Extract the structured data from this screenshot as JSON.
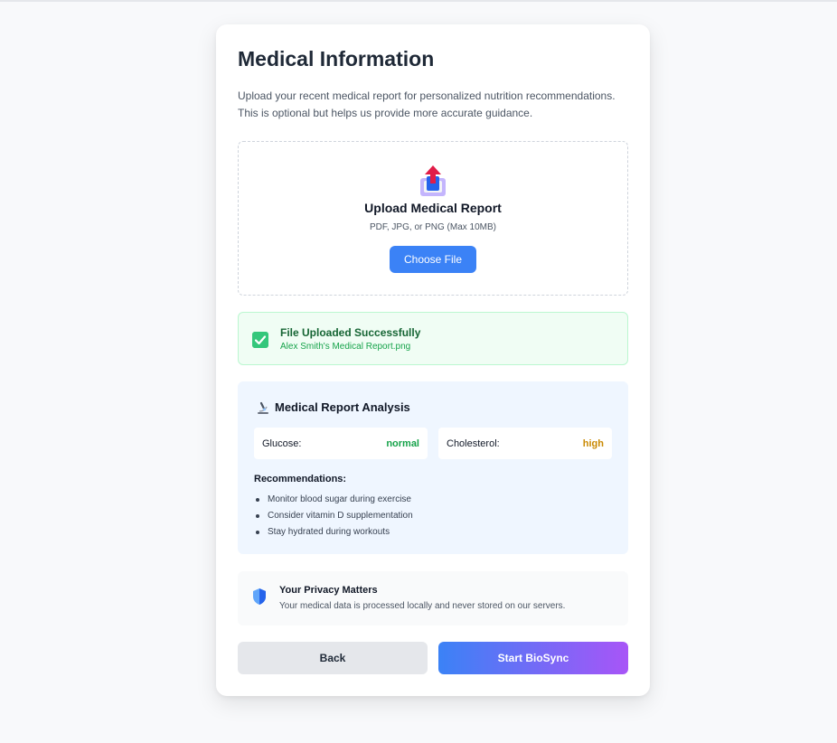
{
  "page": {
    "title": "Medical Information",
    "intro": "Upload your recent medical report for personalized nutrition recommendations. This is optional but helps us provide more accurate guidance."
  },
  "upload": {
    "icon": "upload-tray-icon",
    "title": "Upload Medical Report",
    "hint": "PDF, JPG, or PNG (Max 10MB)",
    "button_label": "Choose File"
  },
  "success": {
    "icon": "checkmark-icon",
    "title": "File Uploaded Successfully",
    "filename": "Alex Smith's Medical Report.png"
  },
  "analysis": {
    "icon": "microscope-icon",
    "title": "Medical Report Analysis",
    "metrics": [
      {
        "label": "Glucose:",
        "value": "normal",
        "color": "#16a34a"
      },
      {
        "label": "Cholesterol:",
        "value": "high",
        "color": "#ca8a04"
      }
    ],
    "recommendations_title": "Recommendations:",
    "recommendations": [
      "Monitor blood sugar during exercise",
      "Consider vitamin D supplementation",
      "Stay hydrated during workouts"
    ]
  },
  "privacy": {
    "icon": "shield-icon",
    "title": "Your Privacy Matters",
    "text": "Your medical data is processed locally and never stored on our servers."
  },
  "actions": {
    "back_label": "Back",
    "start_label": "Start BioSync"
  },
  "colors": {
    "primary": "#3b82f6",
    "gradient_end": "#a855f7",
    "success": "#16a34a",
    "warning": "#ca8a04"
  }
}
